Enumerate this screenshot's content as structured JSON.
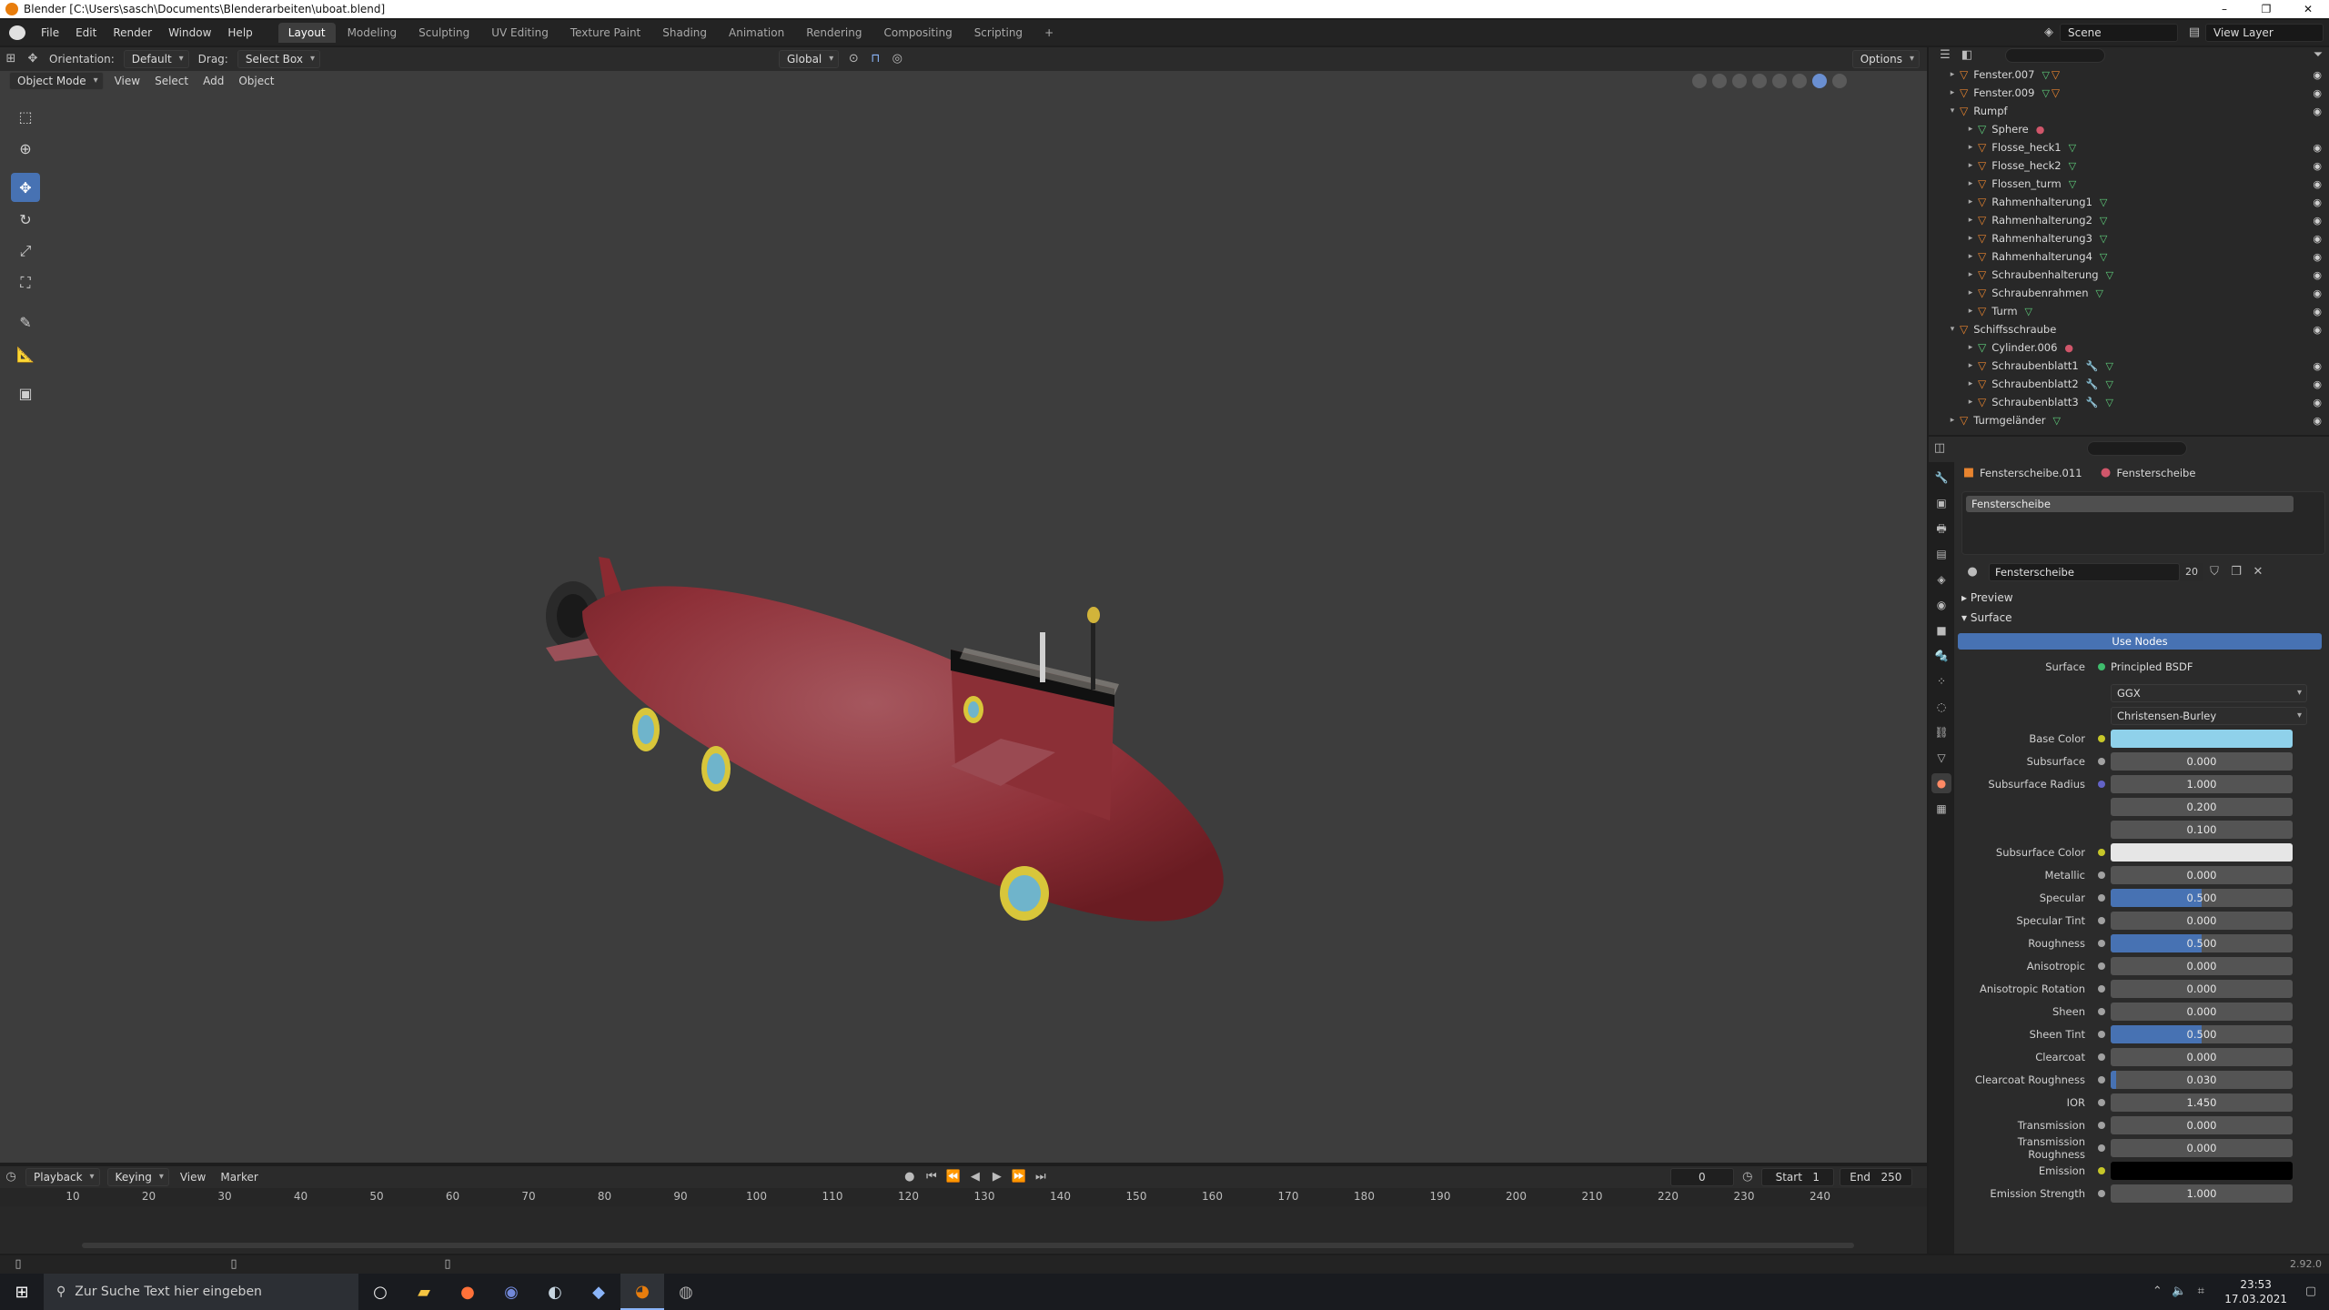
{
  "window": {
    "title": "Blender [C:\\Users\\sasch\\Documents\\Blenderarbeiten\\uboat.blend]",
    "minimize": "–",
    "maximize": "❐",
    "close": "✕"
  },
  "menu": {
    "items": [
      "File",
      "Edit",
      "Render",
      "Window",
      "Help"
    ],
    "workspaces": [
      "Layout",
      "Modeling",
      "Sculpting",
      "UV Editing",
      "Texture Paint",
      "Shading",
      "Animation",
      "Rendering",
      "Compositing",
      "Scripting",
      "+"
    ],
    "scene": "Scene",
    "view_layer": "View Layer"
  },
  "tool_header": {
    "orientation_label": "Orientation:",
    "orientation_value": "Default",
    "drag_label": "Drag:",
    "drag_value": "Select Box",
    "transform": "Global",
    "options": "Options"
  },
  "viewport_header": {
    "mode": "Object Mode",
    "menus": [
      "View",
      "Select",
      "Add",
      "Object"
    ]
  },
  "outliner": {
    "rows": [
      {
        "name": "Fenster.007",
        "indent": 1,
        "icons": [
          "mesh",
          "obj"
        ]
      },
      {
        "name": "Fenster.009",
        "indent": 1,
        "icons": [
          "mesh",
          "obj"
        ]
      },
      {
        "name": "Rumpf",
        "indent": 1,
        "icons": []
      },
      {
        "name": "Sphere",
        "indent": 2,
        "icons": [
          "mat"
        ]
      },
      {
        "name": "Flosse_heck1",
        "indent": 2,
        "icons": [
          "mesh"
        ]
      },
      {
        "name": "Flosse_heck2",
        "indent": 2,
        "icons": [
          "mesh"
        ]
      },
      {
        "name": "Flossen_turm",
        "indent": 2,
        "icons": [
          "mesh"
        ]
      },
      {
        "name": "Rahmenhalterung1",
        "indent": 2,
        "icons": [
          "mesh"
        ]
      },
      {
        "name": "Rahmenhalterung2",
        "indent": 2,
        "icons": [
          "mesh"
        ]
      },
      {
        "name": "Rahmenhalterung3",
        "indent": 2,
        "icons": [
          "mesh"
        ]
      },
      {
        "name": "Rahmenhalterung4",
        "indent": 2,
        "icons": [
          "mesh"
        ]
      },
      {
        "name": "Schraubenhalterung",
        "indent": 2,
        "icons": [
          "mesh"
        ]
      },
      {
        "name": "Schraubenrahmen",
        "indent": 2,
        "icons": [
          "mesh"
        ]
      },
      {
        "name": "Turm",
        "indent": 2,
        "icons": [
          "mesh"
        ]
      },
      {
        "name": "Schiffsschraube",
        "indent": 1,
        "icons": []
      },
      {
        "name": "Cylinder.006",
        "indent": 2,
        "icons": [
          "mat"
        ]
      },
      {
        "name": "Schraubenblatt1",
        "indent": 2,
        "icons": [
          "mod",
          "mesh"
        ]
      },
      {
        "name": "Schraubenblatt2",
        "indent": 2,
        "icons": [
          "mod",
          "mesh"
        ]
      },
      {
        "name": "Schraubenblatt3",
        "indent": 2,
        "icons": [
          "mod",
          "mesh"
        ]
      },
      {
        "name": "Turmgeländer",
        "indent": 1,
        "icons": [
          "mesh"
        ]
      }
    ]
  },
  "properties": {
    "breadcrumb_object": "Fensterscheibe.011",
    "breadcrumb_material": "Fensterscheibe",
    "slot": "Fensterscheibe",
    "material_name": "Fensterscheibe",
    "material_users": "20",
    "panel_preview": "Preview",
    "panel_surface": "Surface",
    "use_nodes": "Use Nodes",
    "surface_label": "Surface",
    "surface_shader": "Principled BSDF",
    "distribution": "GGX",
    "subsurface_method": "Christensen-Burley",
    "base_color_hex": "#8fd1ea",
    "subsurface_color_hex": "#e6e6e6",
    "emission_hex": "#000000",
    "fields": [
      {
        "label": "Subsurface",
        "value": "0.000",
        "fill": 0
      },
      {
        "label": "Subsurface Radius",
        "value": "1.000",
        "fill": 0
      },
      {
        "label": "",
        "value": "0.200",
        "fill": 0
      },
      {
        "label": "",
        "value": "0.100",
        "fill": 0
      }
    ],
    "fields2": [
      {
        "label": "Metallic",
        "value": "0.000",
        "fill": 0
      },
      {
        "label": "Specular",
        "value": "0.500",
        "fill": 0.5
      },
      {
        "label": "Specular Tint",
        "value": "0.000",
        "fill": 0
      },
      {
        "label": "Roughness",
        "value": "0.500",
        "fill": 0.5
      },
      {
        "label": "Anisotropic",
        "value": "0.000",
        "fill": 0
      },
      {
        "label": "Anisotropic Rotation",
        "value": "0.000",
        "fill": 0
      },
      {
        "label": "Sheen",
        "value": "0.000",
        "fill": 0
      },
      {
        "label": "Sheen Tint",
        "value": "0.500",
        "fill": 0.5
      },
      {
        "label": "Clearcoat",
        "value": "0.000",
        "fill": 0
      },
      {
        "label": "Clearcoat Roughness",
        "value": "0.030",
        "fill": 0.03
      },
      {
        "label": "IOR",
        "value": "1.450",
        "fill": 0
      },
      {
        "label": "Transmission",
        "value": "0.000",
        "fill": 0
      },
      {
        "label": "Transmission Roughness",
        "value": "0.000",
        "fill": 0
      }
    ],
    "labels": {
      "base_color": "Base Color",
      "subsurface_color": "Subsurface Color",
      "emission": "Emission",
      "emission_strength": "Emission Strength"
    },
    "emission_strength": "1.000"
  },
  "timeline": {
    "menus": [
      "Playback",
      "Keying",
      "View",
      "Marker"
    ],
    "current_frame": "0",
    "start_label": "Start",
    "start": "1",
    "end_label": "End",
    "end": "250",
    "ticks": [
      "10",
      "20",
      "30",
      "40",
      "50",
      "60",
      "70",
      "80",
      "90",
      "100",
      "110",
      "120",
      "130",
      "140",
      "150",
      "160",
      "170",
      "180",
      "190",
      "200",
      "210",
      "220",
      "230",
      "240"
    ]
  },
  "statusbar": {
    "version": "2.92.0"
  },
  "taskbar": {
    "search_placeholder": "Zur Suche Text hier eingeben",
    "time": "23:53",
    "date": "17.03.2021"
  }
}
